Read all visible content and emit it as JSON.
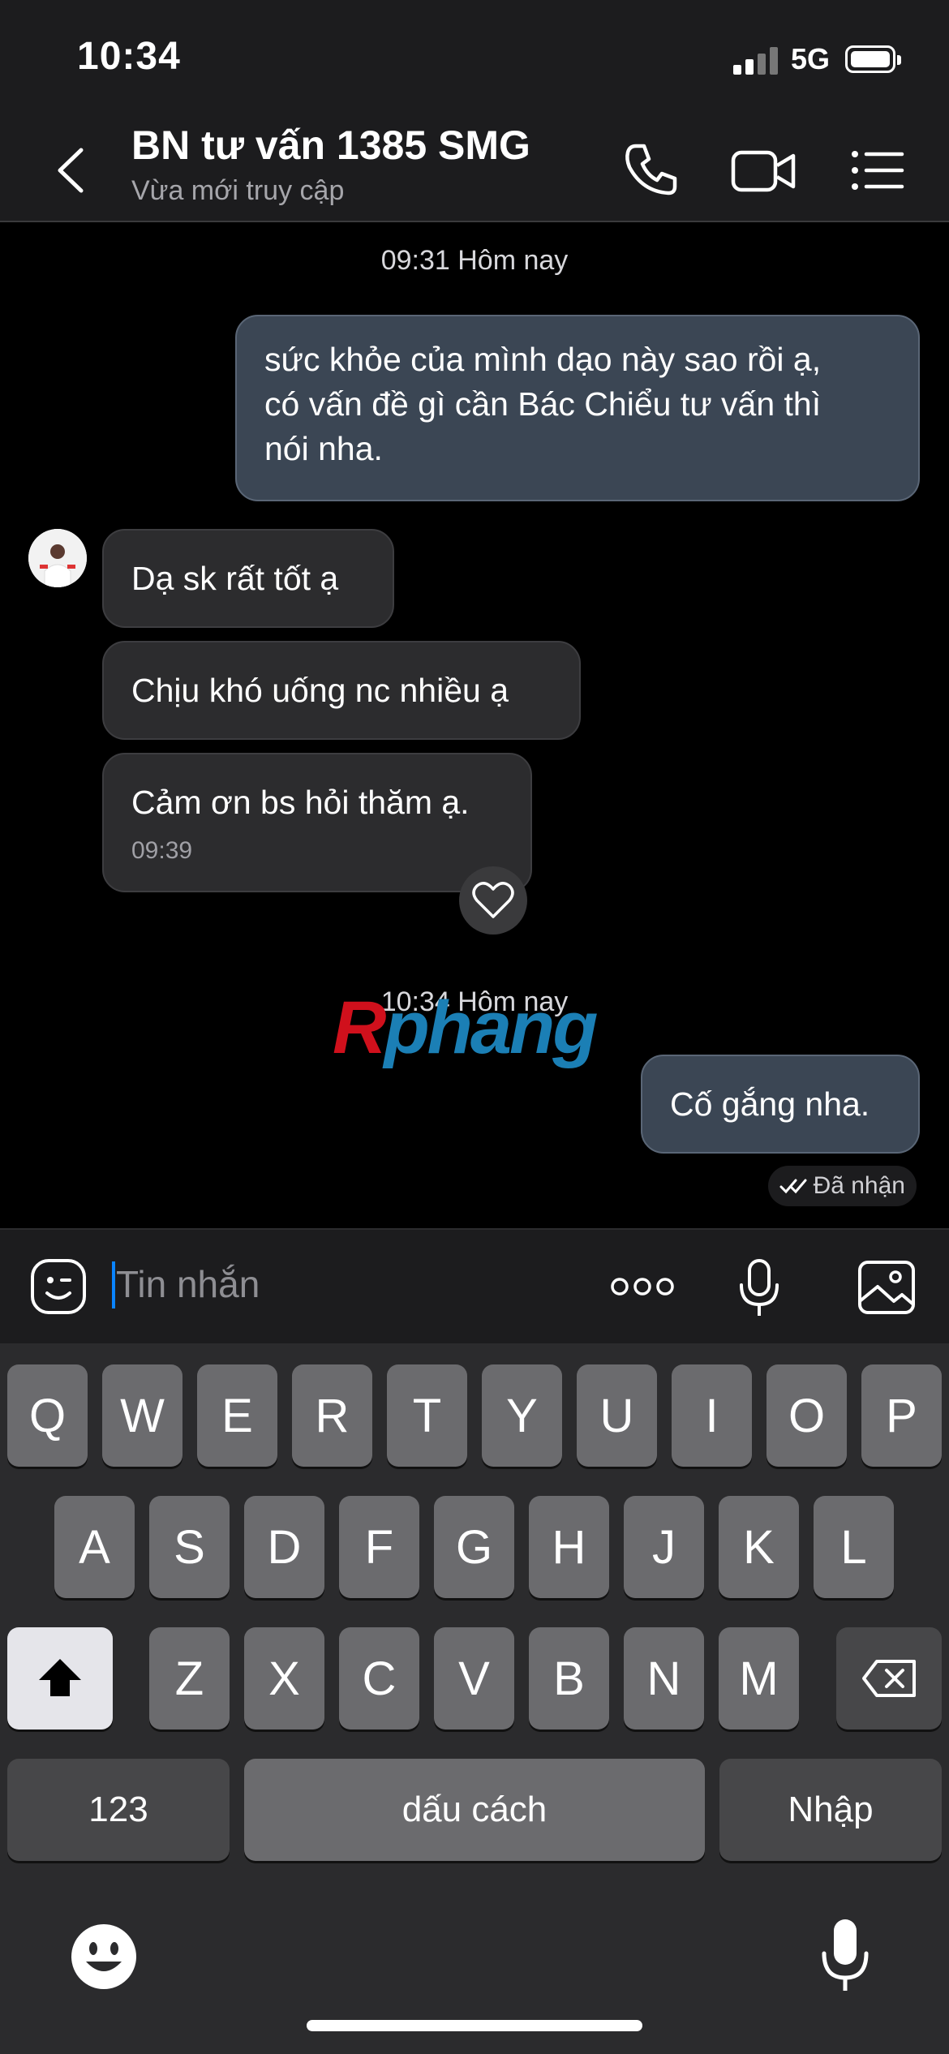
{
  "status_bar": {
    "time": "10:34",
    "network": "5G"
  },
  "header": {
    "title": "BN tư vấn 1385 SMG",
    "subtitle": "Vừa mới truy cập"
  },
  "chat": {
    "timestamp_1": "09:31 Hôm nay",
    "outgoing_1": [
      "sức khỏe của mình dạo này sao rồi ạ,",
      "có vấn đề gì cần Bác Chiểu tư vấn thì",
      "nói nha."
    ],
    "incoming_1": "Dạ sk rất tốt ạ",
    "incoming_2": "Chịu khó uống nc nhiều ạ",
    "incoming_3": "Cảm ơn bs hỏi thăm ạ.",
    "incoming_3_time": "09:39",
    "timestamp_2": "10:34 Hôm nay",
    "outgoing_2": "Cố gắng nha.",
    "read_status": "Đã nhận",
    "watermark_red": "R",
    "watermark_blue": "phang"
  },
  "input": {
    "placeholder": "Tin nhắn"
  },
  "keyboard": {
    "row1": [
      "Q",
      "W",
      "E",
      "R",
      "T",
      "Y",
      "U",
      "I",
      "O",
      "P"
    ],
    "row2": [
      "A",
      "S",
      "D",
      "F",
      "G",
      "H",
      "J",
      "K",
      "L"
    ],
    "row3": [
      "Z",
      "X",
      "C",
      "V",
      "B",
      "N",
      "M"
    ],
    "numbers_key": "123",
    "space_key": "dấu cách",
    "return_key": "Nhập"
  }
}
